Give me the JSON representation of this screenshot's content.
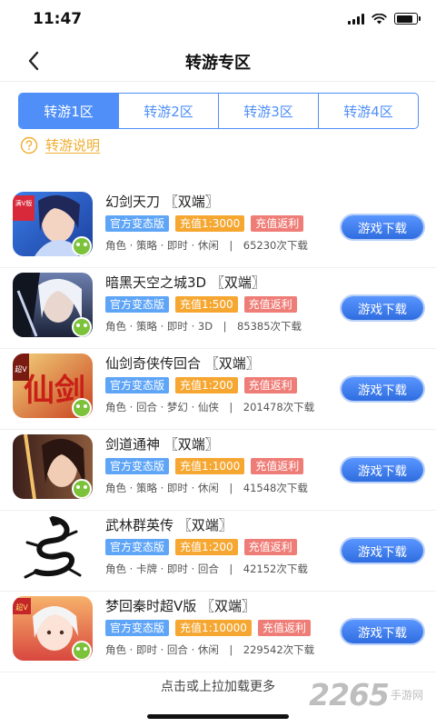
{
  "status_bar": {
    "time": "11:47",
    "battery_level": 0.85
  },
  "nav": {
    "title": "转游专区",
    "back_icon": "chevron-left-icon"
  },
  "tabs": [
    {
      "label": "转游1区",
      "active": true
    },
    {
      "label": "转游2区",
      "active": false
    },
    {
      "label": "转游3区",
      "active": false
    },
    {
      "label": "转游4区",
      "active": false
    }
  ],
  "help": {
    "label": "转游说明",
    "icon": "question-circle-icon"
  },
  "tag_colors": {
    "version": "#5fa5f7",
    "recharge": "#f5a731",
    "rebate": "#ef7d77"
  },
  "games": [
    {
      "name": "幻剑天刀 〖双端〗",
      "tag_version": "官方变态版",
      "tag_recharge": "充值1:3000",
      "tag_rebate": "充值返利",
      "meta": "角色 · 策略 · 即时 · 休闲　|　65230次下载",
      "button": "游戏下载",
      "icon_badge": "满V版"
    },
    {
      "name": "暗黑天空之城3D 〖双端〗",
      "tag_version": "官方变态版",
      "tag_recharge": "充值1:500",
      "tag_rebate": "充值返利",
      "meta": "角色 · 策略 · 即时 · 3D　|　85385次下载",
      "button": "游戏下载",
      "icon_badge": ""
    },
    {
      "name": "仙剑奇侠传回合 〖双端〗",
      "tag_version": "官方变态版",
      "tag_recharge": "充值1:200",
      "tag_rebate": "充值返利",
      "meta": "角色 · 回合 · 梦幻 · 仙侠　|　201478次下载",
      "button": "游戏下载",
      "icon_badge": "超V",
      "icon_art_text": "仙剑"
    },
    {
      "name": "剑道通神 〖双端〗",
      "tag_version": "官方变态版",
      "tag_recharge": "充值1:1000",
      "tag_rebate": "充值返利",
      "meta": "角色 · 策略 · 即时 · 休闲　|　41548次下载",
      "button": "游戏下载",
      "icon_badge": ""
    },
    {
      "name": "武林群英传 〖双端〗",
      "tag_version": "官方变态版",
      "tag_recharge": "充值1:200",
      "tag_rebate": "充值返利",
      "meta": "角色 · 卡牌 · 即时 · 回合　|　42152次下载",
      "button": "游戏下载",
      "icon_badge": ""
    },
    {
      "name": "梦回秦时超V版 〖双端〗",
      "tag_version": "官方变态版",
      "tag_recharge": "充值1:10000",
      "tag_rebate": "充值返利",
      "meta": "角色 · 即时 · 回合 · 休闲　|　229542次下载",
      "button": "游戏下载",
      "icon_badge": "超V"
    }
  ],
  "footer": {
    "load_more": "点击或上拉加载更多"
  },
  "watermark": {
    "number": "2265",
    "suffix": "手游网"
  }
}
